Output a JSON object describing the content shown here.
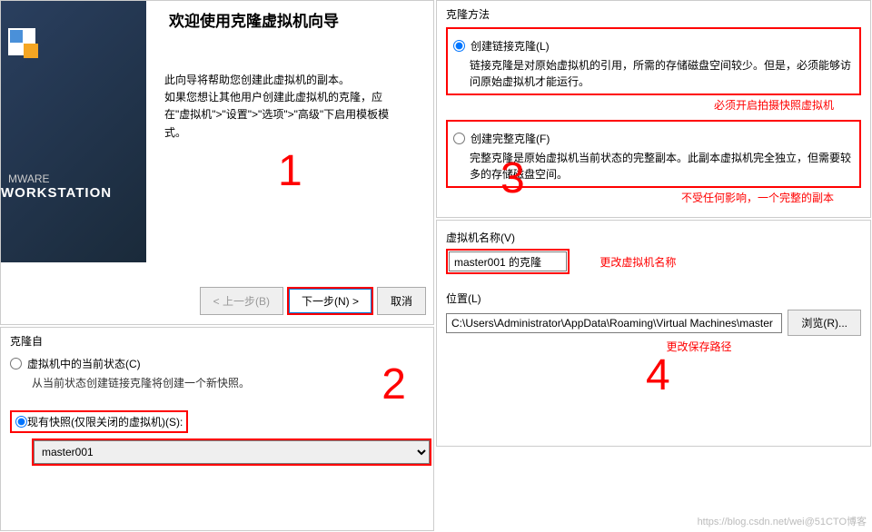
{
  "panel1": {
    "brand_small": "MWARE",
    "brand_big": "WORKSTATION",
    "title": "欢迎使用克隆虚拟机向导",
    "desc": "此向导将帮助您创建此虚拟机的副本。\n如果您想让其他用户创建此虚拟机的克隆，应在\"虚拟机\">\"设置\">\"选项\">\"高级\"下启用模板模式。",
    "number": "1",
    "btn_prev": "< 上一步(B)",
    "btn_next": "下一步(N) >",
    "btn_cancel": "取消"
  },
  "panel2": {
    "title": "克隆自",
    "opt1_label": "虚拟机中的当前状态(C)",
    "opt1_desc": "从当前状态创建链接克隆将创建一个新快照。",
    "opt2_label": "现有快照(仅限关闭的虚拟机)(S):",
    "select_value": "master001",
    "number": "2"
  },
  "panel3": {
    "title": "克隆方法",
    "opt1_label": "创建链接克隆(L)",
    "opt1_desc": "链接克隆是对原始虚拟机的引用，所需的存储磁盘空间较少。但是，必须能够访问原始虚拟机才能运行。",
    "opt1_note": "必须开启拍摄快照虚拟机",
    "opt2_label": "创建完整克隆(F)",
    "opt2_desc": "完整克隆是原始虚拟机当前状态的完整副本。此副本虚拟机完全独立，但需要较多的存储磁盘空间。",
    "opt2_note": "不受任何影响，一个完整的副本",
    "number": "3"
  },
  "panel4": {
    "name_label": "虚拟机名称(V)",
    "name_value": "master001 的克隆",
    "name_note": "更改虚拟机名称",
    "loc_label": "位置(L)",
    "loc_value": "C:\\Users\\Administrator\\AppData\\Roaming\\Virtual Machines\\master",
    "browse": "浏览(R)...",
    "loc_note": "更改保存路径",
    "number": "4"
  },
  "watermark": "https://blog.csdn.net/wei@51CTO博客"
}
